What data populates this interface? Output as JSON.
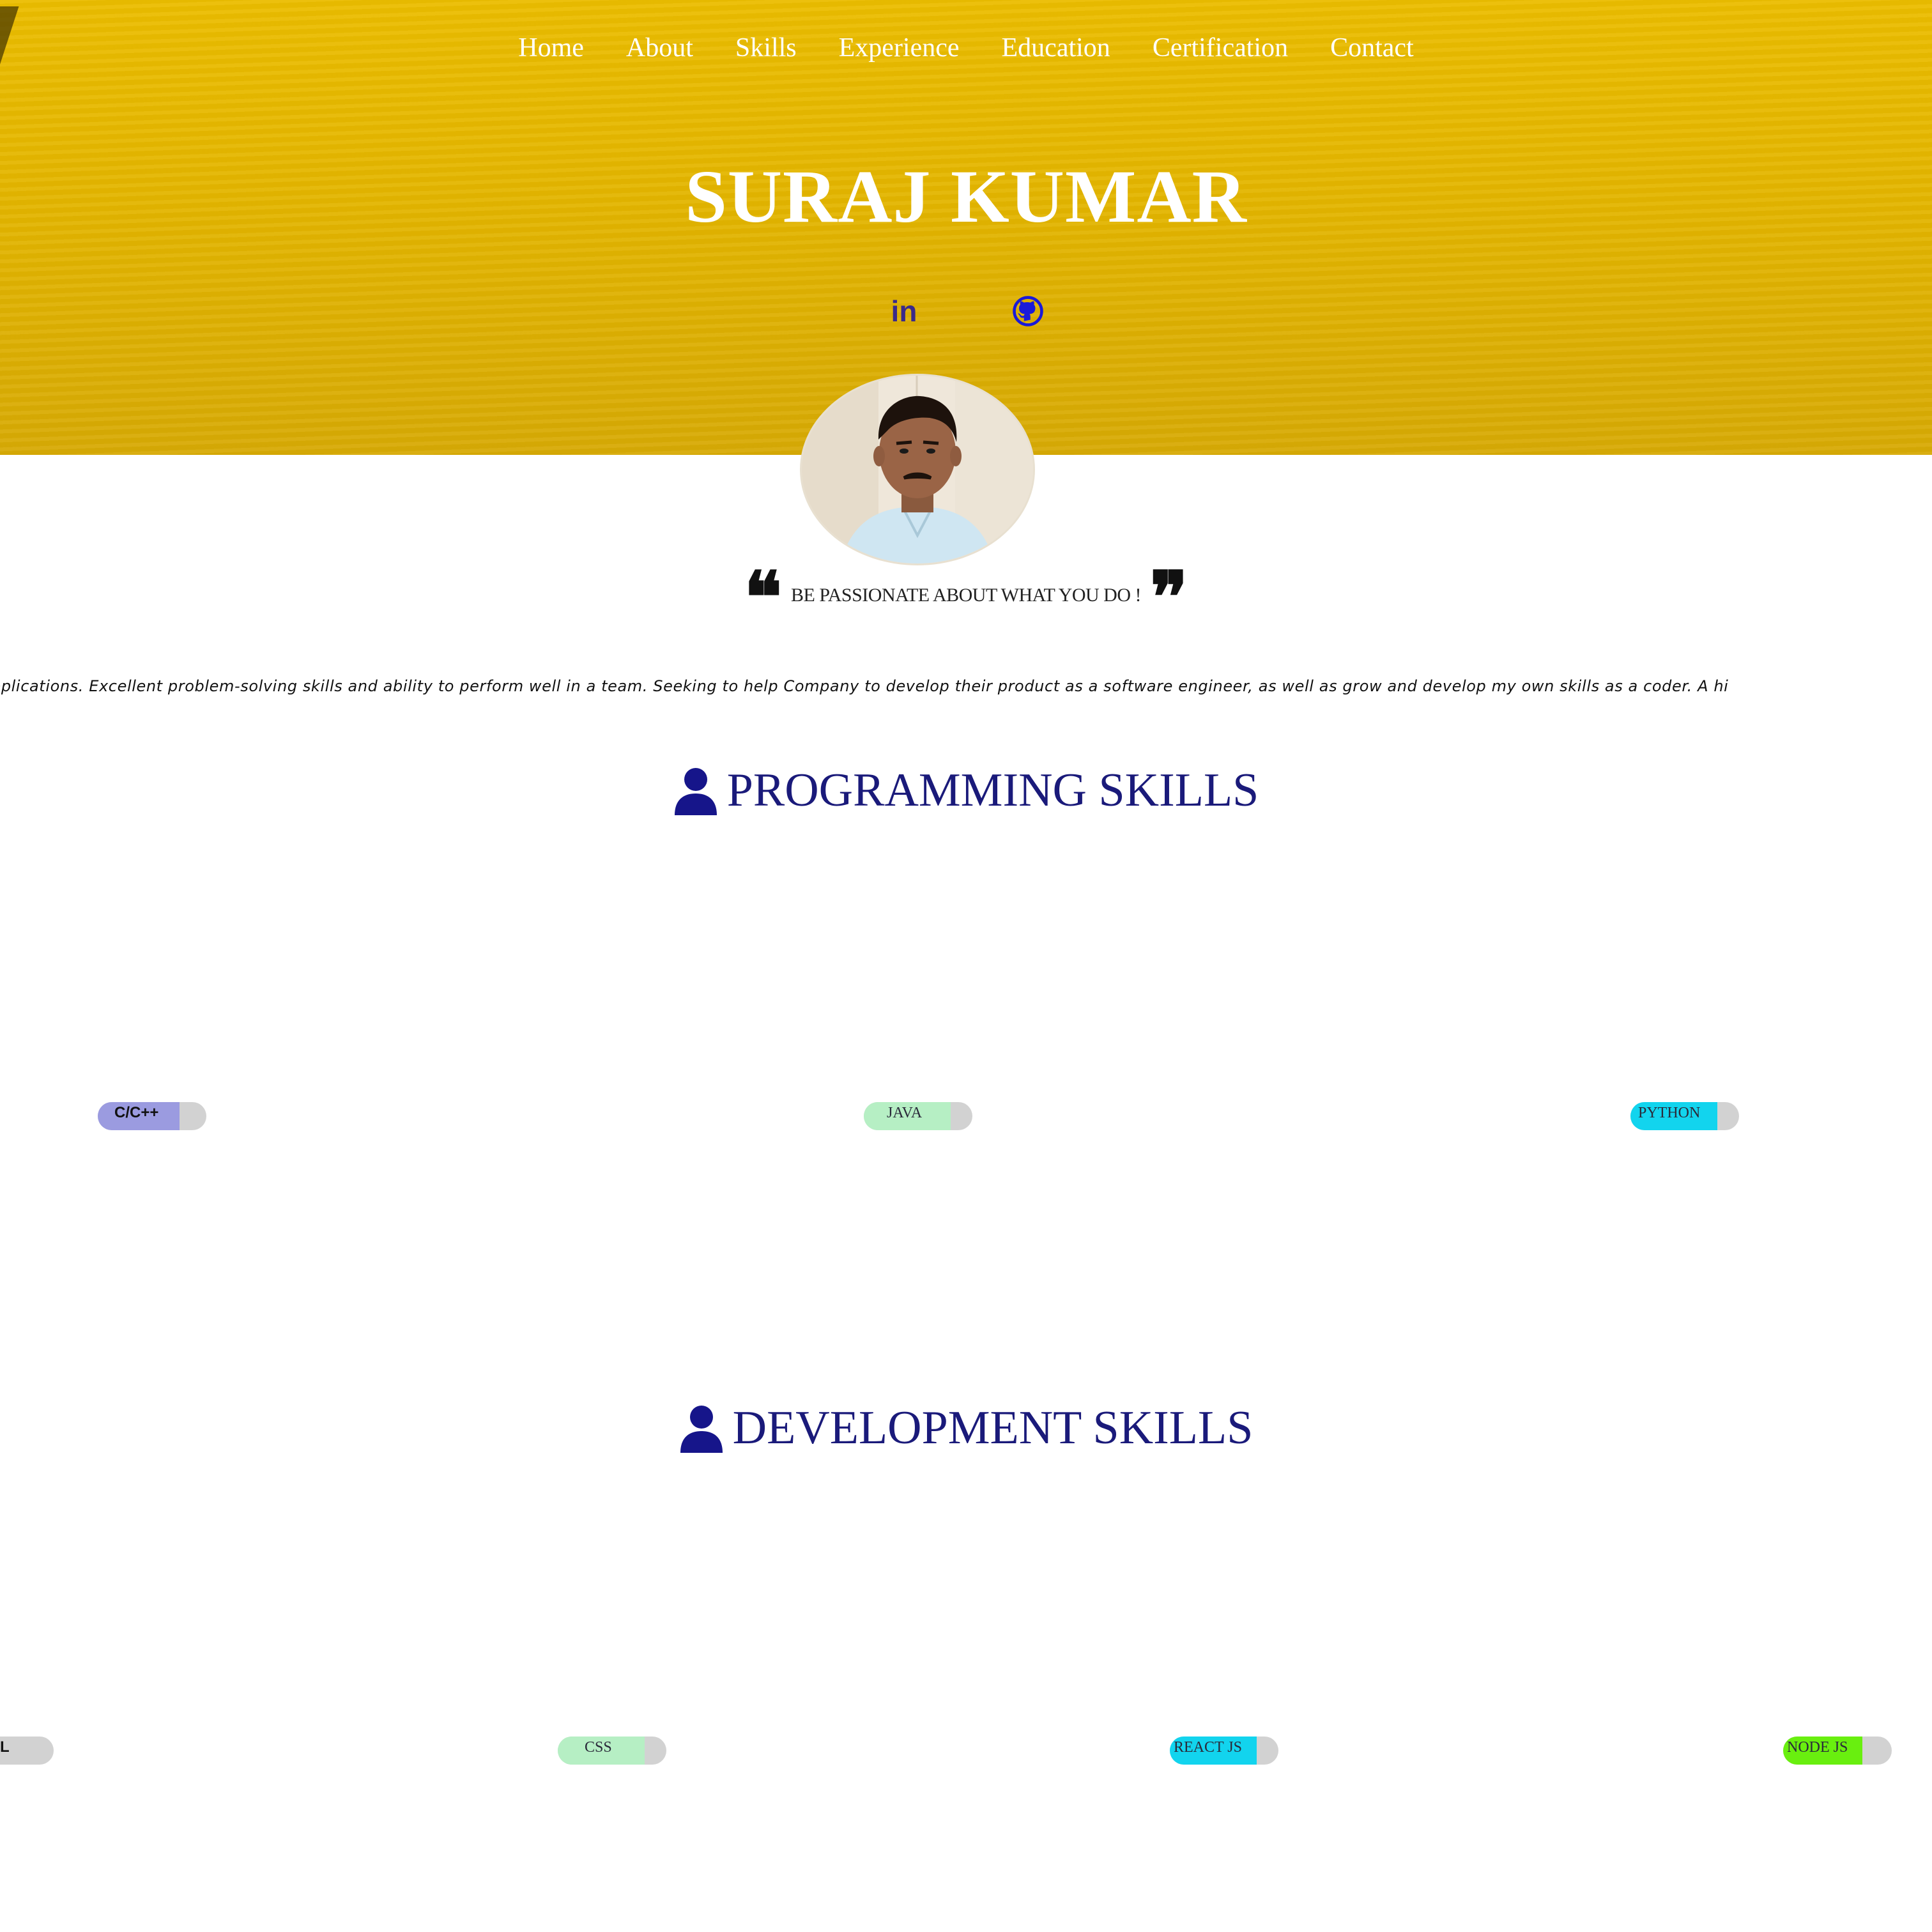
{
  "nav": {
    "items": [
      {
        "label": "Home"
      },
      {
        "label": "About"
      },
      {
        "label": "Skills"
      },
      {
        "label": "Experience"
      },
      {
        "label": "Education"
      },
      {
        "label": "Certification"
      },
      {
        "label": "Contact"
      }
    ]
  },
  "hero": {
    "name": "SURAJ KUMAR",
    "social": [
      {
        "icon": "linkedin-icon",
        "glyph": "in"
      },
      {
        "icon": "github-icon"
      }
    ],
    "avatar": "profile-photo"
  },
  "quote": {
    "text": "BE PASSIONATE ABOUT WHAT YOU DO !"
  },
  "about_marquee": "pplications. Excellent problem-solving skills and ability to perform well in a team. Seeking to help Company to develop their product as a software engineer, as well as grow and develop my own skills as a coder. A hi",
  "skills": {
    "programming": {
      "title": "PROGRAMMING SKILLS",
      "icon": "user-icon",
      "items": [
        {
          "label": "C/C++",
          "level": 0.75,
          "color": "#9b9be0"
        },
        {
          "label": "JAVA",
          "level": 0.8,
          "color": "#b6efc4"
        },
        {
          "label": "PYTHON",
          "level": 0.8,
          "color": "#12d4ee"
        }
      ]
    },
    "development": {
      "title": "DEVELOPMENT SKILLS",
      "icon": "user-icon",
      "items": [
        {
          "label": "L",
          "level": 0.25,
          "color": "#9b9be0"
        },
        {
          "label": "CSS",
          "level": 0.8,
          "color": "#b6efc4"
        },
        {
          "label": "REACT JS",
          "level": 0.8,
          "color": "#12d4ee"
        },
        {
          "label": "NODE JS",
          "level": 0.73,
          "color": "#69ef0f"
        }
      ]
    }
  },
  "colors": {
    "hero_bg": "#e3b500",
    "heading_text": "#1a1a7a",
    "icon_blue": "#16158a",
    "track": "#d2d2d2"
  }
}
